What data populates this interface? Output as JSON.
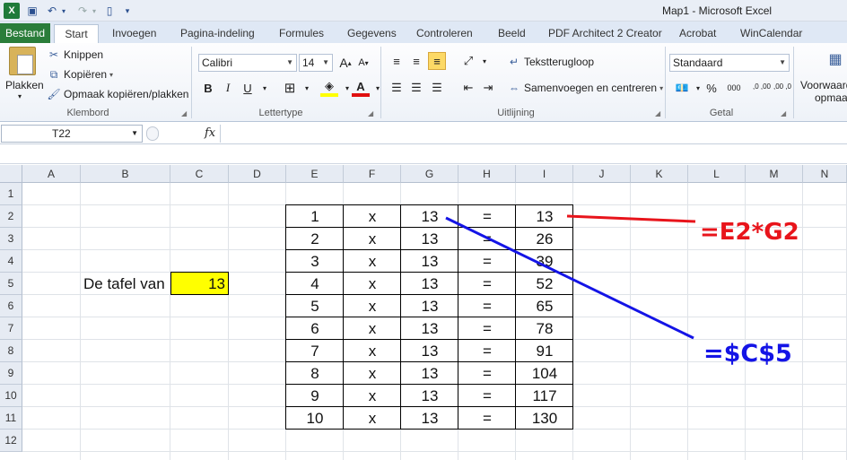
{
  "window": {
    "title": "Map1 - Microsoft Excel"
  },
  "tabs": [
    {
      "label": "Bestand"
    },
    {
      "label": "Start"
    },
    {
      "label": "Invoegen"
    },
    {
      "label": "Pagina-indeling"
    },
    {
      "label": "Formules"
    },
    {
      "label": "Gegevens"
    },
    {
      "label": "Controleren"
    },
    {
      "label": "Beeld"
    },
    {
      "label": "PDF Architect 2 Creator"
    },
    {
      "label": "Acrobat"
    },
    {
      "label": "WinCalendar"
    }
  ],
  "ribbon": {
    "clipboard": {
      "paste": "Plakken",
      "cut": "Knippen",
      "copy": "Kopiëren",
      "format_painter": "Opmaak kopiëren/plakken",
      "label": "Klembord"
    },
    "font": {
      "name": "Calibri",
      "size": "14",
      "label": "Lettertype",
      "bold": "B",
      "italic": "I",
      "underline": "U"
    },
    "alignment": {
      "wrap": "Tekstterugloop",
      "merge": "Samenvoegen en centreren",
      "label": "Uitlijning"
    },
    "number": {
      "format": "Standaard",
      "percent": "%",
      "comma": "000",
      "inc": ",0 ,00",
      "dec": ",00 ,0",
      "label": "Getal"
    },
    "styles": {
      "cond": "Voorwaardelijke",
      "cond2": "opmaak"
    }
  },
  "formula_bar": {
    "name_box": "T22",
    "fx": "fx",
    "formula": ""
  },
  "columns": [
    "A",
    "B",
    "C",
    "D",
    "E",
    "F",
    "G",
    "H",
    "I",
    "J",
    "K",
    "L",
    "M",
    "N"
  ],
  "rows": [
    "1",
    "2",
    "3",
    "4",
    "5",
    "6",
    "7",
    "8",
    "9",
    "10",
    "11",
    "12"
  ],
  "cells": {
    "label": "De tafel van",
    "number": "13"
  },
  "table": [
    {
      "e": "1",
      "f": "x",
      "g": "13",
      "h": "=",
      "i": "13"
    },
    {
      "e": "2",
      "f": "x",
      "g": "13",
      "h": "=",
      "i": "26"
    },
    {
      "e": "3",
      "f": "x",
      "g": "13",
      "h": "=",
      "i": "39"
    },
    {
      "e": "4",
      "f": "x",
      "g": "13",
      "h": "=",
      "i": "52"
    },
    {
      "e": "5",
      "f": "x",
      "g": "13",
      "h": "=",
      "i": "65"
    },
    {
      "e": "6",
      "f": "x",
      "g": "13",
      "h": "=",
      "i": "78"
    },
    {
      "e": "7",
      "f": "x",
      "g": "13",
      "h": "=",
      "i": "91"
    },
    {
      "e": "8",
      "f": "x",
      "g": "13",
      "h": "=",
      "i": "104"
    },
    {
      "e": "9",
      "f": "x",
      "g": "13",
      "h": "=",
      "i": "117"
    },
    {
      "e": "10",
      "f": "x",
      "g": "13",
      "h": "=",
      "i": "130"
    }
  ],
  "annotations": {
    "red_formula": "=E2*G2",
    "blue_formula": "=$C$5",
    "red_color": "#e8141b",
    "blue_color": "#1414e6"
  },
  "colors": {
    "file_tab": "#2a7d3a",
    "highlight": "#ffff00"
  }
}
